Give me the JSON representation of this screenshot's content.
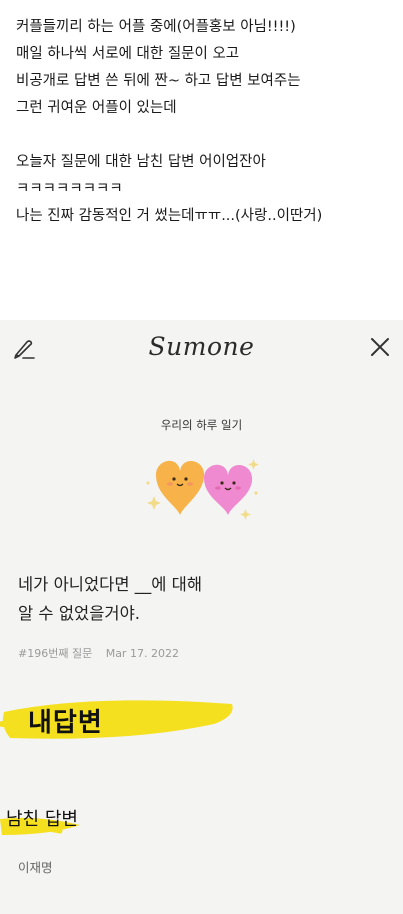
{
  "post": {
    "lines": [
      "커플들끼리 하는 어플 중에(어플홍보 아님!!!!)",
      "매일 하나씩 서로에 대한 질문이 오고",
      "비공개로 답변 쓴 뒤에 짠~ 하고 답변 보여주는",
      "그런 귀여운 어플이 있는데",
      "오늘자 질문에 대한 남친 답변 어이업잔아",
      "ㅋㅋㅋㅋㅋㅋㅋㅋ",
      "나는 진짜 감동적인 거 썼는데ㅠㅠ...(사랑..이딴거)"
    ]
  },
  "app": {
    "title": "Sumone",
    "diary_title": "우리의 하루 일기",
    "question_lines": [
      "네가 아니었다면 __에 대해",
      "알 수 없었을거야."
    ],
    "question_number": "#196번째 질문",
    "question_date": "Mar 17. 2022",
    "my_answer_label": "내답변",
    "bf_answer_label": "남친 답변",
    "bf_name": "이재명",
    "icons": {
      "edit": "edit-pencil-icon",
      "close": "close-icon",
      "hearts": "couple-hearts-icon"
    },
    "colors": {
      "highlight": "#f5e020",
      "heart_left": "#f7b24a",
      "heart_right": "#f08ad0"
    }
  }
}
